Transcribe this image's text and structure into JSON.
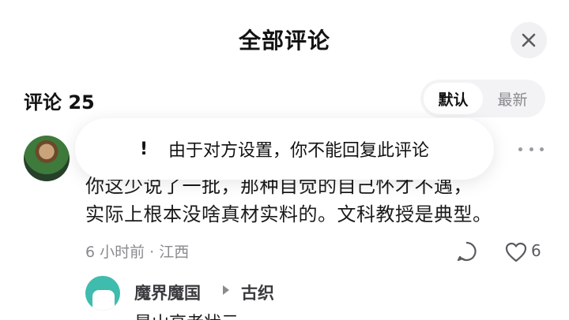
{
  "header": {
    "title": "全部评论"
  },
  "comments_section": {
    "count_label": "评论 25",
    "sort": {
      "options": [
        "默认",
        "最新"
      ],
      "selected": "默认"
    }
  },
  "toast": {
    "icon": "exclamation",
    "message": "由于对方设置，你不能回复此评论"
  },
  "comment": {
    "line1": "你这少说了一批，那种自觉的自己怀才不遇，",
    "line2": "实际上根本没啥真材实料的。文科教授是典型。",
    "meta": "6 小时前 · 江西",
    "like_count": "6"
  },
  "reply": {
    "author": "魔界魔国",
    "target": "古织",
    "text": "是山高者状元"
  }
}
